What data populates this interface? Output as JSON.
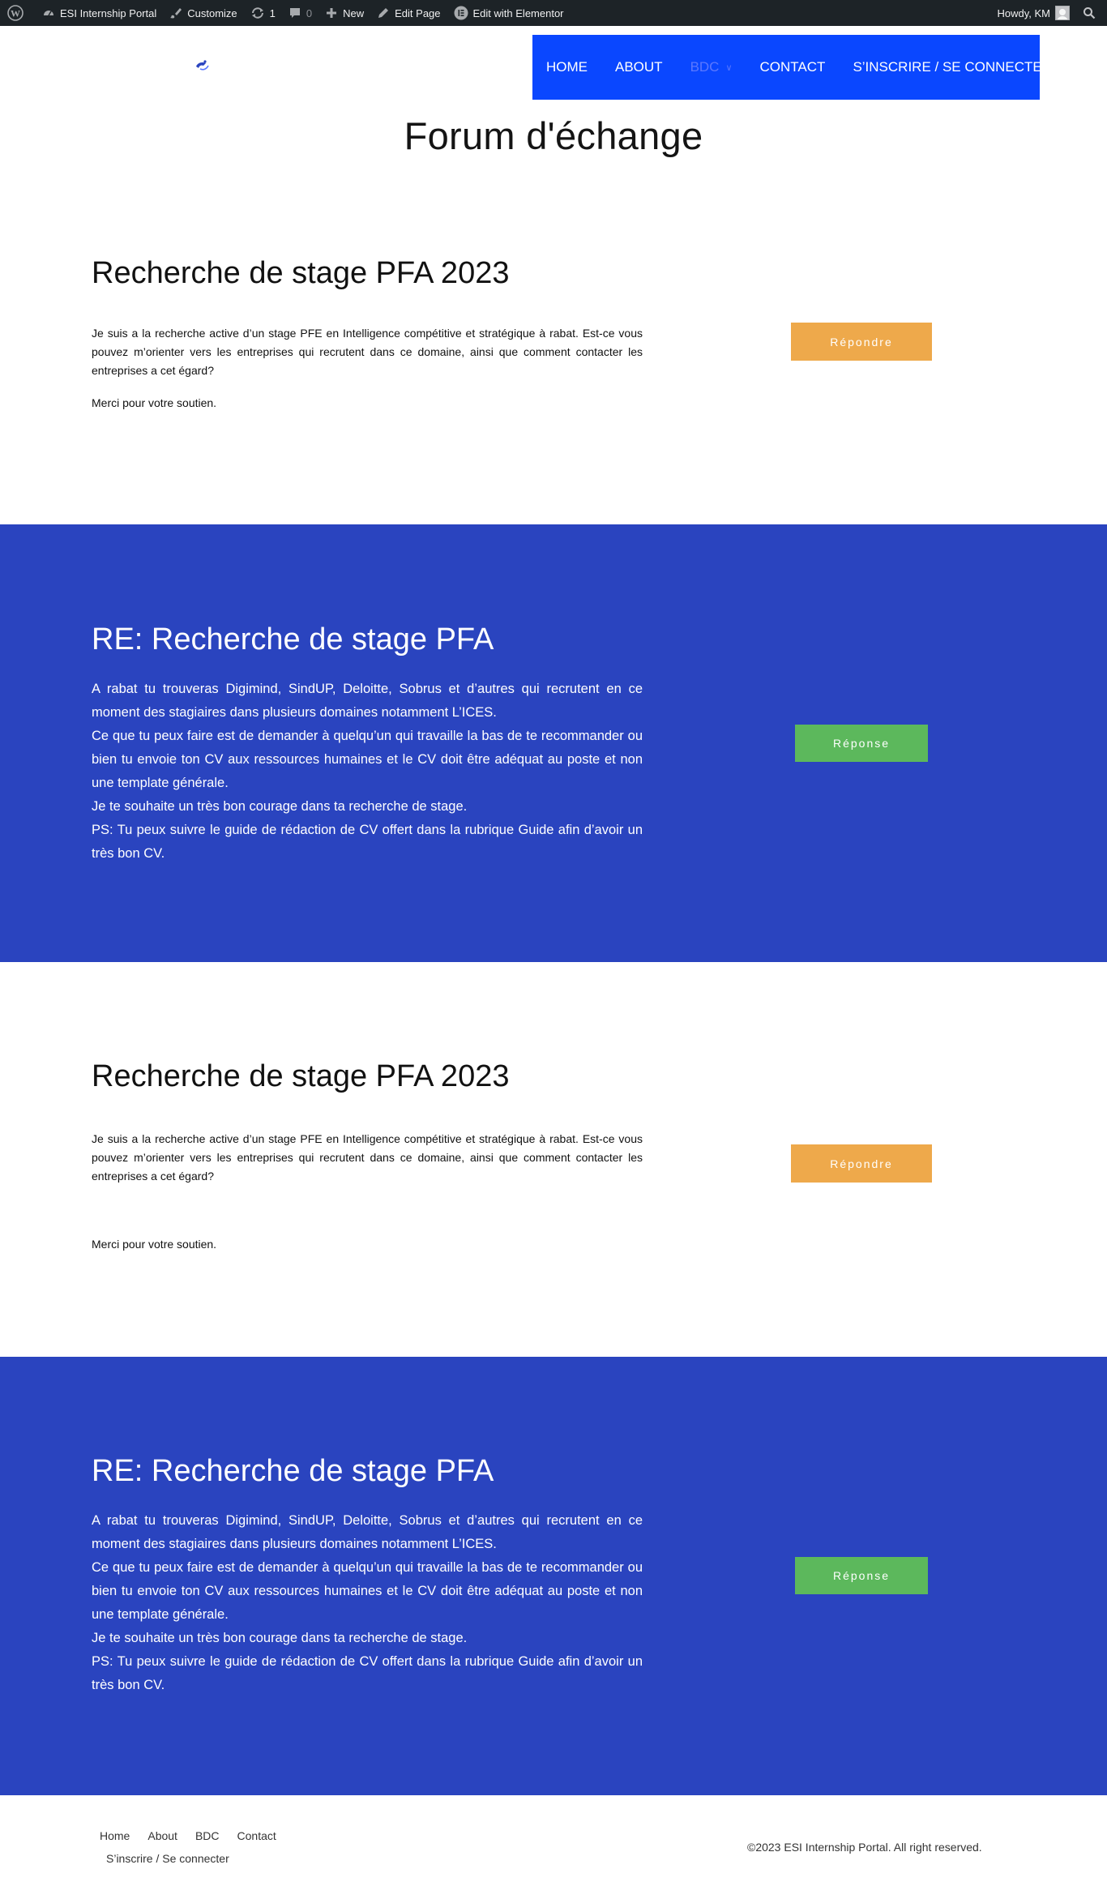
{
  "adminbar": {
    "site_name": "ESI Internship Portal",
    "customize": "Customize",
    "updates_count": "1",
    "comments_count": "0",
    "new": "New",
    "edit_page": "Edit Page",
    "edit_elementor": "Edit with Elementor",
    "howdy": "Howdy, KM"
  },
  "nav": {
    "items": [
      "HOME",
      "ABOUT",
      "BDC",
      "CONTACT",
      "S’INSCRIRE / SE CONNECTER"
    ]
  },
  "page": {
    "title": "Forum d'échange"
  },
  "posts": [
    {
      "title": "Recherche de stage PFA 2023",
      "body": "Je suis a la recherche active d’un stage PFE en Intelligence compétitive et stratégique à rabat. Est-ce vous pouvez m’orienter vers les entreprises qui recrutent dans ce domaine, ainsi que comment contacter les entreprises a cet égard?",
      "signoff": "Merci pour votre soutien.",
      "button": "Répondre"
    },
    {
      "title": "RE: Recherche de stage PFA",
      "lines": [
        "A rabat tu trouveras Digimind, SindUP, Deloitte, Sobrus et d’autres qui recrutent en ce moment des stagiaires dans plusieurs domaines notamment L’ICES.",
        "Ce que tu peux faire est de demander à quelqu’un qui travaille la bas de te recommander ou bien tu envoie ton CV aux ressources humaines et le CV doit être adéquat au poste et non une template générale.",
        "Je te souhaite un très bon courage dans ta recherche de stage.",
        "PS: Tu peux suivre le guide de rédaction de CV offert dans la rubrique Guide afin d’avoir un très bon CV."
      ],
      "button": "Réponse"
    },
    {
      "title": "Recherche de stage PFA 2023",
      "body": "Je suis a la recherche active d’un stage PFE en Intelligence compétitive et stratégique à rabat. Est-ce vous pouvez m’orienter vers les entreprises qui recrutent dans ce domaine, ainsi que comment contacter les entreprises a cet égard?",
      "signoff": "Merci pour votre soutien.",
      "button": "Répondre"
    },
    {
      "title": "RE: Recherche de stage PFA",
      "lines": [
        "A rabat tu trouveras Digimind, SindUP, Deloitte, Sobrus et d’autres qui recrutent en ce moment des stagiaires dans plusieurs domaines notamment L’ICES.",
        "Ce que tu peux faire est de demander à quelqu’un qui travaille la bas de te recommander ou bien tu envoie ton CV aux ressources humaines et le CV doit être adéquat au poste et non une template générale.",
        "Je te souhaite un très bon courage dans ta recherche de stage.",
        "PS: Tu peux suivre le guide de rédaction de CV offert dans la rubrique Guide afin d’avoir un très bon CV."
      ],
      "button": "Réponse"
    }
  ],
  "footer": {
    "links": [
      "Home",
      "About",
      "BDC",
      "Contact"
    ],
    "link2": "S’inscrire / Se connecter",
    "copyright": "©2023 ESI Internship Portal. All right reserved."
  },
  "colors": {
    "nav_bg": "#0a47ff",
    "blue_section": "#2a44bf",
    "reply_button": "#eea94b",
    "answer_button": "#5cb85c",
    "adminbar": "#1d2327"
  },
  "icons": [
    "wordpress-icon",
    "dashboard-icon",
    "brush-icon",
    "refresh-icon",
    "comment-icon",
    "plus-icon",
    "pencil-icon",
    "elementor-icon",
    "user-avatar-icon",
    "search-icon",
    "site-logo-icon",
    "chevron-down-icon"
  ]
}
